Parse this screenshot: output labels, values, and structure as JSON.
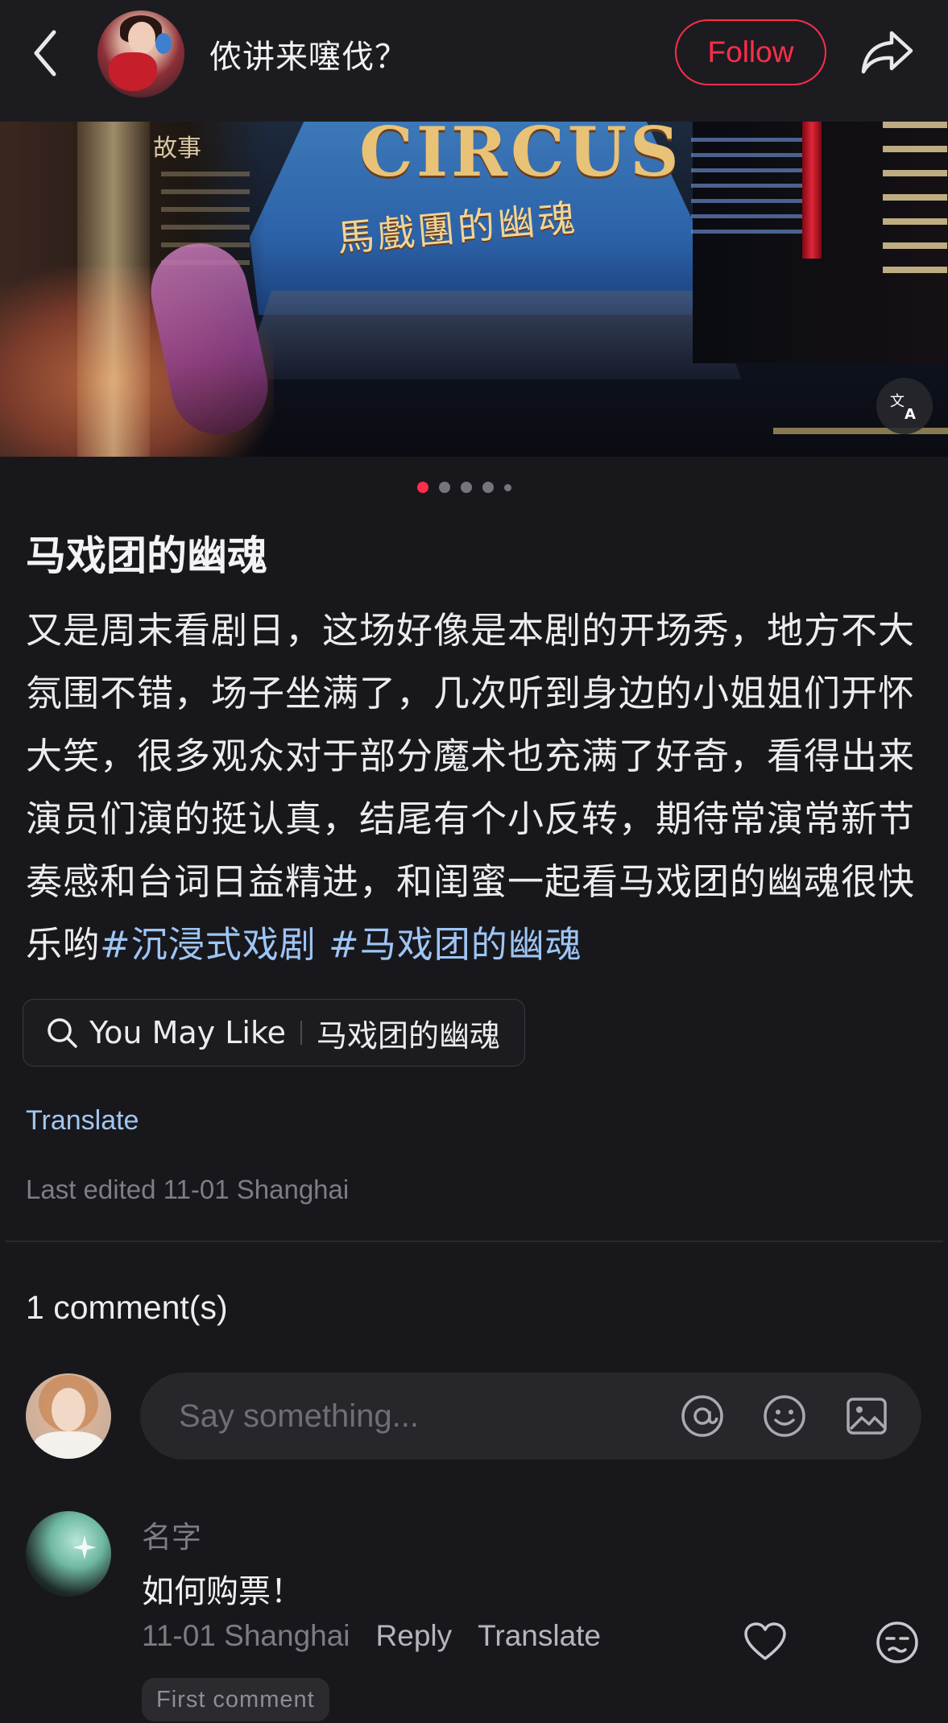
{
  "header": {
    "author_name": "侬讲来噻伐？",
    "follow_label": "Follow"
  },
  "carousel": {
    "image_text_main": "CIRCUS",
    "image_text_sub": "馬戲團的幽魂",
    "image_text_left": "故事",
    "page_count": 5,
    "current_page": 1
  },
  "post": {
    "title": "马戏团的幽魂",
    "body": "又是周末看剧日，这场好像是本剧的开场秀，地方不大氛围不错，场子坐满了，几次听到身边的小姐姐们开怀大笑，很多观众对于部分魔术也充满了好奇，看得出来演员们演的挺认真，结尾有个小反转，期待常演常新节奏感和台词日益精进，和闺蜜一起看马戏团的幽魂很快乐哟",
    "tags": [
      "#沉浸式戏剧",
      "#马戏团的幽魂"
    ],
    "you_may_like_label": "You May Like",
    "you_may_like_query": "马戏团的幽魂",
    "translate_label": "Translate",
    "edited_text": "Last edited 11-01 Shanghai"
  },
  "comments": {
    "count_label": "1 comment(s)",
    "input_placeholder": "Say something...",
    "items": [
      {
        "name": "名字",
        "text": "如何购票！",
        "date": "11-01 Shanghai",
        "reply_label": "Reply",
        "translate_label": "Translate",
        "badge": "First comment"
      }
    ]
  },
  "colors": {
    "accent": "#ff2d4a",
    "link": "#9ec5f5",
    "background": "#18181c"
  },
  "icons": [
    "back-arrow-icon",
    "share-icon",
    "translate-icon",
    "search-icon",
    "at-icon",
    "emoji-icon",
    "image-icon",
    "heart-icon",
    "unamused-emoji-icon"
  ]
}
